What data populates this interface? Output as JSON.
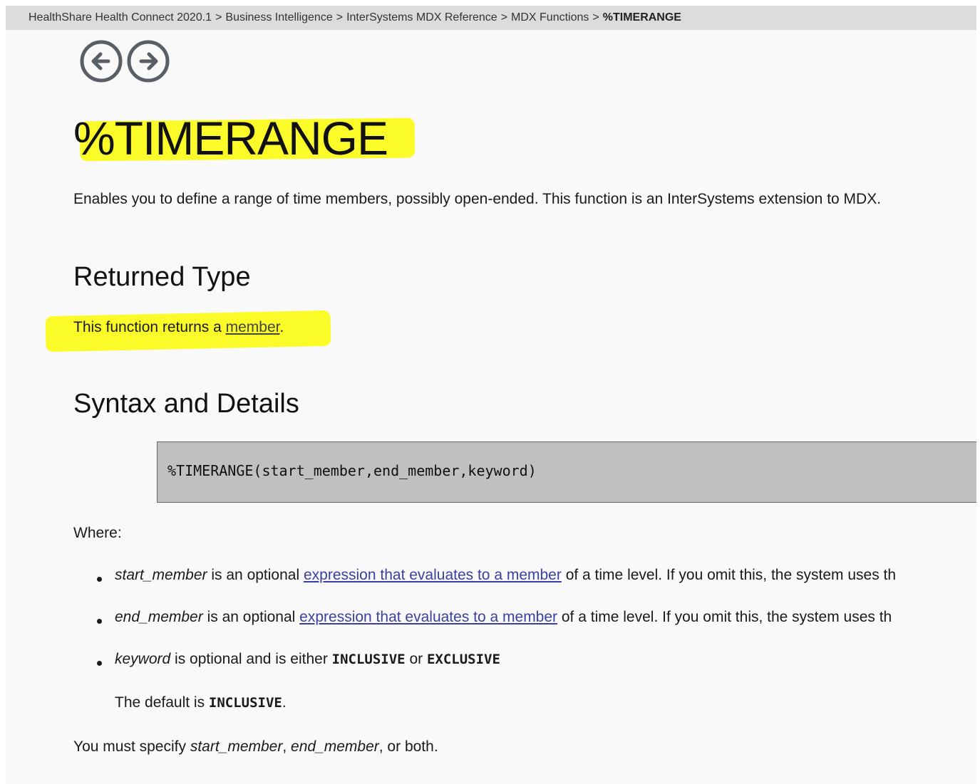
{
  "breadcrumb": {
    "items": [
      "HealthShare Health Connect 2020.1",
      "Business Intelligence",
      "InterSystems MDX Reference",
      "MDX Functions"
    ],
    "current": "%TIMERANGE",
    "separator": ">"
  },
  "nav": {
    "back_icon": "arrow-left-circle-icon",
    "forward_icon": "arrow-right-circle-icon"
  },
  "title": "%TIMERANGE",
  "intro": "Enables you to define a range of time members, possibly open-ended. This function is an InterSystems extension to MDX.",
  "returned_type": {
    "heading": "Returned Type",
    "text_before": "This function returns a ",
    "link": "member",
    "text_after": "."
  },
  "syntax": {
    "heading": "Syntax and Details",
    "code": "%TIMERANGE(start_member,end_member,keyword)"
  },
  "where_label": "Where:",
  "params": [
    {
      "name": "start_member",
      "text_before": " is an optional ",
      "link": "expression that evaluates to a member",
      "text_after": " of a time level. If you omit this, the system uses th"
    },
    {
      "name": "end_member",
      "text_before": " is an optional ",
      "link": "expression that evaluates to a member",
      "text_after": " of a time level. If you omit this, the system uses th"
    },
    {
      "name": "keyword",
      "text_before": " is optional and is either ",
      "kw1": "INCLUSIVE",
      "or": " or ",
      "kw2": "EXCLUSIVE"
    }
  ],
  "default_note": {
    "before": "The default is ",
    "kw": "INCLUSIVE",
    "after": "."
  },
  "must_specify": {
    "before": "You must specify ",
    "p1": "start_member",
    "comma": ", ",
    "p2": "end_member",
    "after": ", or both."
  },
  "colors": {
    "highlight": "#fbfb1e",
    "link": "#3b3fa0",
    "code_bg": "#c0c0c0",
    "breadcrumb_bg": "#dcdcdc"
  }
}
